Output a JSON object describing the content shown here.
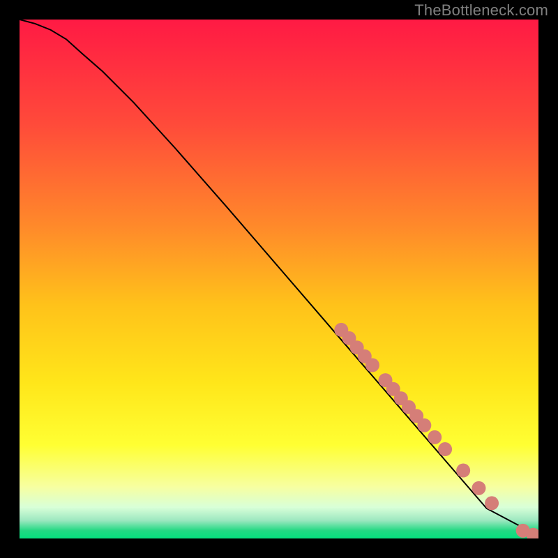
{
  "attribution": "TheBottleneck.com",
  "chart_data": {
    "type": "line",
    "title": "",
    "xlabel": "",
    "ylabel": "",
    "xlim": [
      0,
      100
    ],
    "ylim": [
      0,
      100
    ],
    "background_gradient": {
      "stops": [
        {
          "offset": 0.0,
          "color": "#ff1a44"
        },
        {
          "offset": 0.2,
          "color": "#ff4a3a"
        },
        {
          "offset": 0.4,
          "color": "#ff8a2a"
        },
        {
          "offset": 0.55,
          "color": "#ffc21a"
        },
        {
          "offset": 0.7,
          "color": "#ffe61a"
        },
        {
          "offset": 0.82,
          "color": "#ffff33"
        },
        {
          "offset": 0.9,
          "color": "#f7ffa0"
        },
        {
          "offset": 0.94,
          "color": "#d8ffd8"
        },
        {
          "offset": 0.965,
          "color": "#9DE8C0"
        },
        {
          "offset": 0.985,
          "color": "#22d983"
        },
        {
          "offset": 1.0,
          "color": "#05e07e"
        }
      ]
    },
    "series": [
      {
        "name": "curve",
        "stroke": "#000000",
        "x": [
          0,
          3,
          6,
          9,
          12,
          16,
          22,
          30,
          40,
          50,
          60,
          70,
          80,
          90,
          100
        ],
        "y": [
          100,
          99.2,
          98.0,
          96.2,
          93.5,
          90.0,
          84.0,
          75.2,
          63.8,
          52.2,
          40.6,
          29.0,
          17.4,
          5.8,
          0.5
        ]
      }
    ],
    "points": {
      "fill": "#d57e78",
      "radius_px": 10,
      "xy": [
        [
          62,
          40.2
        ],
        [
          63.5,
          38.6
        ],
        [
          65,
          36.8
        ],
        [
          66.5,
          35.1
        ],
        [
          68,
          33.4
        ],
        [
          70.5,
          30.5
        ],
        [
          72,
          28.8
        ],
        [
          73.5,
          27.0
        ],
        [
          75,
          25.3
        ],
        [
          76.5,
          23.6
        ],
        [
          78,
          21.8
        ],
        [
          80,
          19.5
        ],
        [
          82,
          17.2
        ],
        [
          85.5,
          13.1
        ],
        [
          88.5,
          9.7
        ],
        [
          91,
          6.8
        ],
        [
          97,
          1.5
        ],
        [
          99,
          0.7
        ]
      ]
    }
  }
}
